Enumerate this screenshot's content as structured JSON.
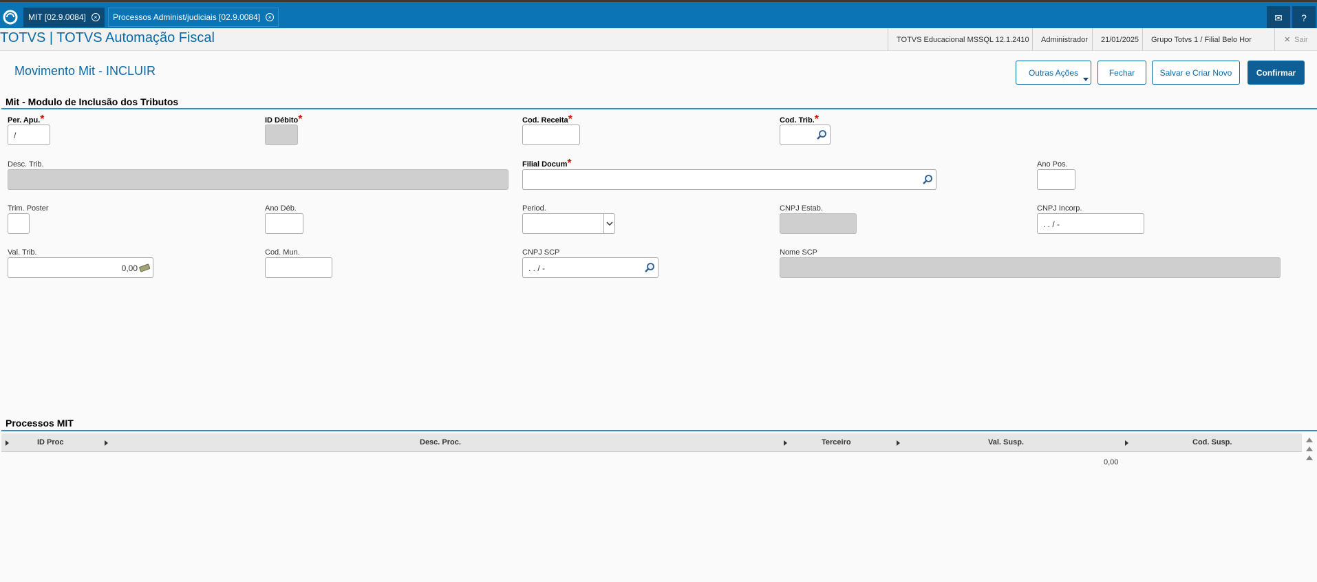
{
  "topbar": {
    "tabs": [
      {
        "label": "MIT [02.9.0084]"
      },
      {
        "label": "Processos Administ/judiciais [02.9.0084]"
      }
    ]
  },
  "header": {
    "app_title": "TOTVS | TOTVS Automação Fiscal",
    "environment": "TOTVS Educacional MSSQL 12.1.2410",
    "user": "Administrador",
    "date": "21/01/2025",
    "branch": "Grupo Totvs 1 / Filial Belo Hor",
    "exit_label": "Sair"
  },
  "page": {
    "title": "Movimento Mit - INCLUIR",
    "buttons": {
      "other_actions": "Outras Ações",
      "close": "Fechar",
      "save_new": "Salvar e Criar Novo",
      "confirm": "Confirmar"
    }
  },
  "form": {
    "section_title": "Mit - Modulo de Inclusão dos Tributos",
    "per_apu": {
      "label": "Per. Apu.",
      "value": "/"
    },
    "id_debito": {
      "label": "ID Débito",
      "value": ""
    },
    "cod_receita": {
      "label": "Cod. Receita",
      "value": ""
    },
    "cod_trib": {
      "label": "Cod. Trib.",
      "value": ""
    },
    "desc_trib": {
      "label": "Desc. Trib.",
      "value": ""
    },
    "filial_docum": {
      "label": "Filial Docum",
      "value": ""
    },
    "ano_pos": {
      "label": "Ano Pos.",
      "value": ""
    },
    "trim_poster": {
      "label": "Trim. Poster",
      "value": ""
    },
    "ano_deb": {
      "label": "Ano Déb.",
      "value": ""
    },
    "period": {
      "label": "Period.",
      "value": ""
    },
    "cnpj_estab": {
      "label": "CNPJ Estab.",
      "value": ""
    },
    "cnpj_incorp": {
      "label": "CNPJ Incorp.",
      "value": ". . / -"
    },
    "val_trib": {
      "label": "Val. Trib.",
      "value": "0,00"
    },
    "cod_mun": {
      "label": "Cod. Mun.",
      "value": ""
    },
    "cnpj_scp": {
      "label": "CNPJ SCP",
      "value": ". . / -"
    },
    "nome_scp": {
      "label": "Nome SCP",
      "value": ""
    },
    "required_mark": "*"
  },
  "processes": {
    "section_title": "Processos MIT",
    "columns": [
      "ID Proc",
      "Desc. Proc.",
      "Terceiro",
      "Val. Susp.",
      "Cod. Susp."
    ],
    "rows": [
      {
        "id_proc": "",
        "desc_proc": "",
        "terceiro": "",
        "val_susp": "0,00",
        "cod_susp": ""
      }
    ]
  }
}
